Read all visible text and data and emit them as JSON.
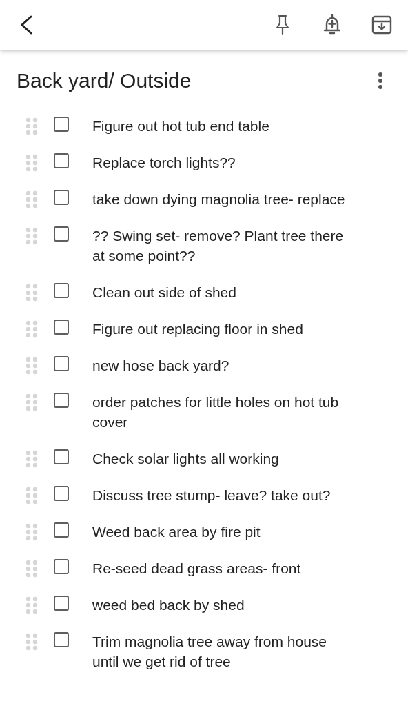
{
  "note": {
    "title": "Back yard/ Outside"
  },
  "items": [
    {
      "text": "Figure out hot tub end table",
      "checked": false
    },
    {
      "text": "Replace torch lights??",
      "checked": false
    },
    {
      "text": "take down dying magnolia tree- replace",
      "checked": false
    },
    {
      "text": "?? Swing set- remove? Plant tree there at some point??",
      "checked": false
    },
    {
      "text": "Clean out side of shed",
      "checked": false
    },
    {
      "text": "Figure out replacing floor in shed",
      "checked": false
    },
    {
      "text": "new hose back yard?",
      "checked": false
    },
    {
      "text": "order patches for little holes on hot tub cover",
      "checked": false
    },
    {
      "text": "Check solar lights all working",
      "checked": false
    },
    {
      "text": "Discuss tree stump- leave? take out?",
      "checked": false
    },
    {
      "text": "Weed back area by fire pit",
      "checked": false
    },
    {
      "text": "Re-seed dead grass areas- front",
      "checked": false
    },
    {
      "text": "weed bed back by shed",
      "checked": false
    },
    {
      "text": "Trim magnolia tree away from house until we get rid of tree",
      "checked": false
    }
  ]
}
